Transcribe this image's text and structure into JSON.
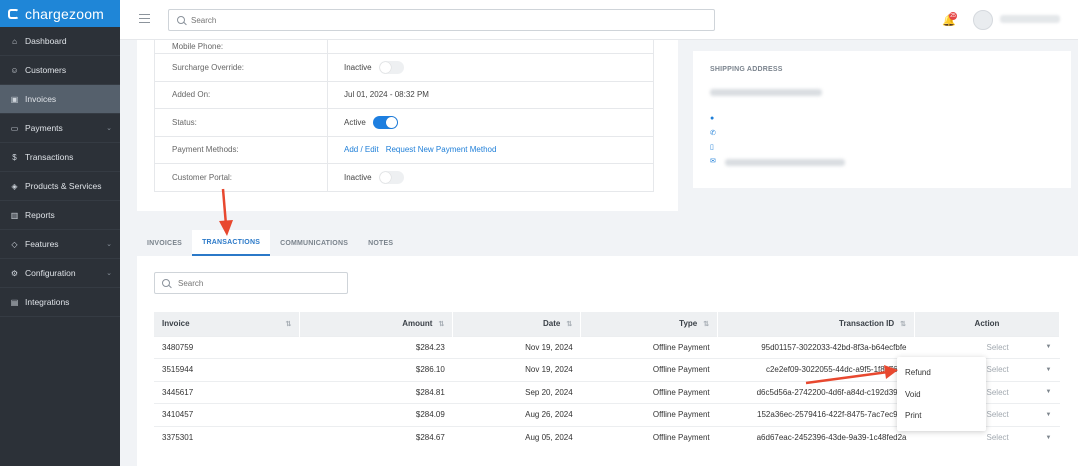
{
  "brand": {
    "name": "chargezoom"
  },
  "sidebar": {
    "items": [
      {
        "label": "Dashboard",
        "icon": "dashboard-icon"
      },
      {
        "label": "Customers",
        "icon": "users-icon"
      },
      {
        "label": "Invoices",
        "icon": "invoice-icon"
      },
      {
        "label": "Payments",
        "icon": "card-icon"
      },
      {
        "label": "Transactions",
        "icon": "dollar-icon"
      },
      {
        "label": "Products & Services",
        "icon": "box-icon"
      },
      {
        "label": "Reports",
        "icon": "bar-chart-icon"
      },
      {
        "label": "Features",
        "icon": "tag-icon"
      },
      {
        "label": "Configuration",
        "icon": "gear-icon"
      },
      {
        "label": "Integrations",
        "icon": "plug-icon"
      }
    ]
  },
  "topbar": {
    "search_placeholder": "Search",
    "notification_count": "25"
  },
  "customer_info": {
    "rows": [
      {
        "label": "Mobile Phone:",
        "value": ""
      },
      {
        "label": "Surcharge Override:",
        "value": "Inactive"
      },
      {
        "label": "Added On:",
        "value": "Jul 01, 2024 - 08:32 PM"
      },
      {
        "label": "Status:",
        "value": "Active"
      },
      {
        "label": "Payment Methods:",
        "link1": "Add / Edit",
        "link2": "Request New Payment Method"
      },
      {
        "label": "Customer Portal:",
        "value": "Inactive"
      }
    ]
  },
  "shipping": {
    "title": "SHIPPING ADDRESS"
  },
  "tabs": [
    {
      "label": "INVOICES"
    },
    {
      "label": "TRANSACTIONS"
    },
    {
      "label": "COMMUNICATIONS"
    },
    {
      "label": "NOTES"
    }
  ],
  "transactions": {
    "search_placeholder": "Search",
    "columns": [
      "Invoice",
      "Amount",
      "Date",
      "Type",
      "Transaction ID",
      "Action"
    ],
    "rows": [
      {
        "invoice": "3480759",
        "amount": "$284.23",
        "date": "Nov 19, 2024",
        "type": "Offline Payment",
        "tid": "95d01157-3022033-42bd-8f3a-b64ecfbfe",
        "action": "Select"
      },
      {
        "invoice": "3515944",
        "amount": "$286.10",
        "date": "Nov 19, 2024",
        "type": "Offline Payment",
        "tid": "c2e2ef09-3022055-44dc-a9f5-1f8c7633",
        "action": "Select"
      },
      {
        "invoice": "3445617",
        "amount": "$284.81",
        "date": "Sep 20, 2024",
        "type": "Offline Payment",
        "tid": "d6c5d56a-2742200-4d6f-a84d-c192d391d",
        "action": "Select"
      },
      {
        "invoice": "3410457",
        "amount": "$284.09",
        "date": "Aug 26, 2024",
        "type": "Offline Payment",
        "tid": "152a36ec-2579416-422f-8475-7ac7ec922",
        "action": "Select"
      },
      {
        "invoice": "3375301",
        "amount": "$284.67",
        "date": "Aug 05, 2024",
        "type": "Offline Payment",
        "tid": "a6d67eac-2452396-43de-9a39-1c48fed2a",
        "action": "Select"
      }
    ]
  },
  "action_menu": {
    "items": [
      "Refund",
      "Void",
      "Print"
    ]
  },
  "colors": {
    "accent": "#1f7fd8",
    "annotation": "#e8482f",
    "sidebar": "#2c3138"
  }
}
